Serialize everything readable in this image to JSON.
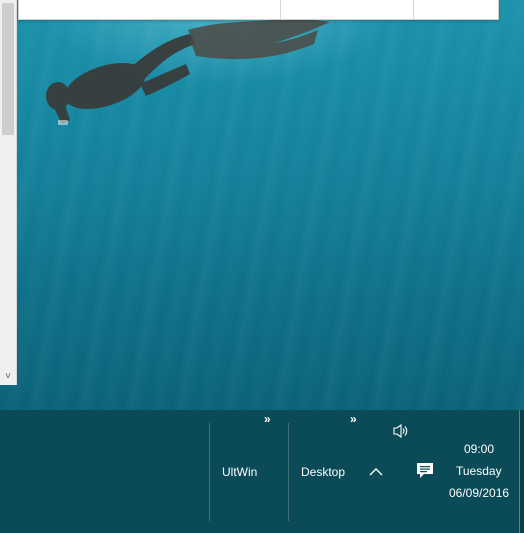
{
  "taskbar": {
    "toolbars": [
      {
        "label": "UltWin",
        "overflow_glyph": "»"
      },
      {
        "label": "Desktop",
        "overflow_glyph": "»"
      }
    ],
    "tray": {
      "show_hidden_glyph": "^",
      "volume_icon": "speaker-icon",
      "notification_icon": "action-center-icon"
    },
    "clock": {
      "time": "09:00",
      "day": "Tuesday",
      "date": "06/09/2016"
    }
  },
  "scrollbar": {
    "down_arrow": "˅"
  },
  "colors": {
    "taskbar": "#0b4a57",
    "wallpaper": "#137f99"
  }
}
